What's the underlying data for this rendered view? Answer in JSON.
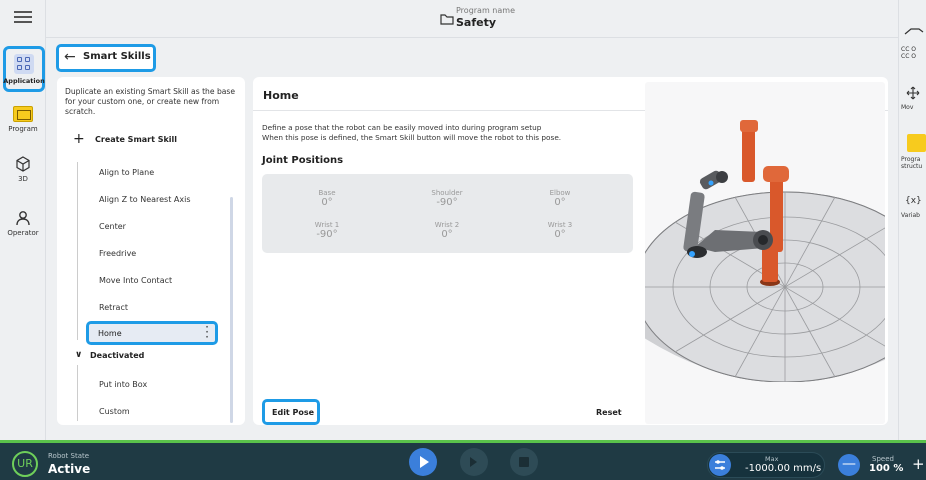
{
  "header": {
    "program_label": "Program name",
    "program_value": "Safety"
  },
  "left_nav": {
    "items": [
      {
        "label": "Application"
      },
      {
        "label": "Program"
      },
      {
        "label": "3D"
      },
      {
        "label": "Operator"
      }
    ]
  },
  "right_nav": {
    "items": [
      {
        "label": "CC O"
      },
      {
        "label": "CC O"
      },
      {
        "label": "Mov"
      },
      {
        "label": "Progra"
      },
      {
        "label": "structu"
      },
      {
        "label": "{x}"
      },
      {
        "label": "Variab"
      }
    ]
  },
  "breadcrumb": {
    "back_label": "Smart Skills"
  },
  "skills_panel": {
    "description": "Duplicate an existing Smart Skill as the base for your custom one, or create new from scratch.",
    "create_label": "Create Smart Skill",
    "skills": [
      "Align to Plane",
      "Align Z to Nearest Axis",
      "Center",
      "Freedrive",
      "Move Into Contact",
      "Retract"
    ],
    "selected": "Home",
    "deactivated_label": "Deactivated",
    "deactivated": [
      "Put into Box",
      "Custom"
    ]
  },
  "detail": {
    "title": "Home",
    "description_1": "Define a pose that the robot can be easily moved into during program setup",
    "description_2": "When this pose is defined, the Smart Skill button will move the robot to this pose.",
    "joint_positions_label": "Joint Positions",
    "joints": [
      {
        "name": "Base",
        "value": "0°"
      },
      {
        "name": "Shoulder",
        "value": "-90°"
      },
      {
        "name": "Elbow",
        "value": "0°"
      },
      {
        "name": "Wrist 1",
        "value": "-90°"
      },
      {
        "name": "Wrist 2",
        "value": "0°"
      },
      {
        "name": "Wrist 3",
        "value": "0°"
      }
    ],
    "edit_pose_label": "Edit Pose",
    "reset_label": "Reset"
  },
  "status_bar": {
    "logo_text": "UR",
    "robot_state_label": "Robot State",
    "robot_state_value": "Active",
    "max_label": "Max",
    "max_value": "-1000.00 mm/s",
    "speed_label": "Speed",
    "speed_value": "100 %",
    "minus_symbol": "—",
    "plus_symbol": "+"
  },
  "colors": {
    "accent": "#1e9be6",
    "status_green": "#5ac24b",
    "bar_bg": "#1f3a44",
    "play_blue": "#3b7fdb",
    "robot_orange": "#d9582b"
  }
}
